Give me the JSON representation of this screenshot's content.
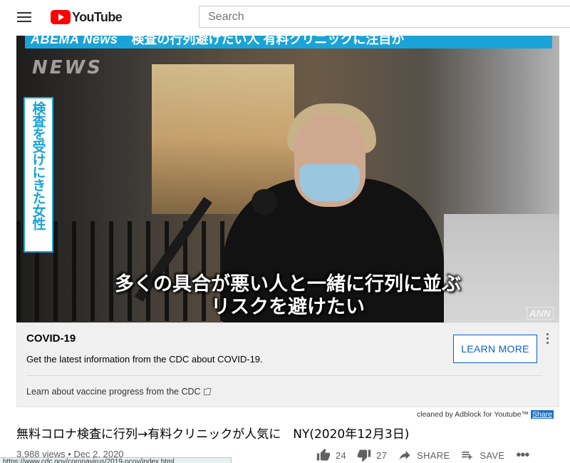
{
  "header": {
    "logo_text": "YouTube",
    "search_placeholder": "Search"
  },
  "video": {
    "top_banner_brand": "ABEMA News",
    "top_banner_text": "検査の行列避けたい人 有料クリニックに注目が",
    "watermark_news": "NEWS",
    "vertical_caption": "検査を受けにきた女性",
    "subtitle_line1": "多くの具合が悪い人と一緒に行列に並ぶ",
    "subtitle_line2": "リスクを避けたい",
    "watermark_ann": "ANN"
  },
  "info_panel": {
    "title": "COVID-19",
    "description": "Get the latest information from the CDC about COVID-19.",
    "button_label": "LEARN MORE",
    "link_text": "Learn about vaccine progress from the CDC"
  },
  "adblock": {
    "text": "cleaned by Adblock for Youtube™",
    "share_label": "Share"
  },
  "title": "無料コロナ検査に行列→有料クリニックが人気に　NY(2020年12月3日)",
  "meta": {
    "views_date": "3,988 views • Dec 2, 2020"
  },
  "actions": {
    "likes": "24",
    "dislikes": "27",
    "share": "SHARE",
    "save": "SAVE"
  },
  "status_bar": {
    "url": "https://www.cdc.gov/coronavirus/2019-ncov/index.html"
  },
  "colors": {
    "brand_red": "#ff0000",
    "link_blue": "#065fd4",
    "caption_blue": "#1aa3d7"
  }
}
